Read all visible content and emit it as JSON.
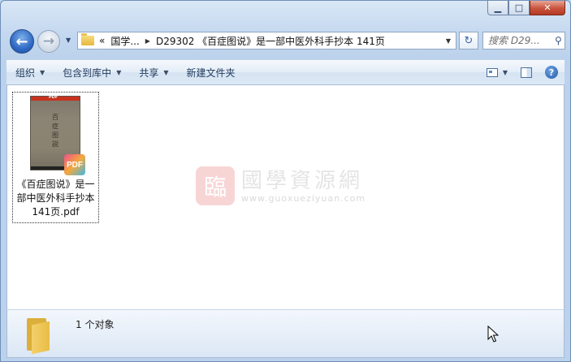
{
  "window": {
    "caption": {
      "minimize": "▁",
      "maximize": "□",
      "close": "✕"
    }
  },
  "nav": {
    "back_glyph": "←",
    "forward_glyph": "→",
    "breadcrumb": {
      "overflow": "«",
      "items": [
        "国学...",
        "D29302 《百症图说》是一部中医外科手抄本 141页"
      ]
    },
    "refresh_glyph": "↻"
  },
  "search": {
    "placeholder": "搜索 D29..."
  },
  "toolbar": {
    "organize": "组织",
    "include_library": "包含到库中",
    "share": "共享",
    "new_folder": "新建文件夹",
    "help_glyph": "?"
  },
  "file": {
    "name": "《百症图说》是一部中医外科手抄本141页.pdf",
    "badge": "PDF",
    "thumb_header": "PDF",
    "thumb_title": "百症图説"
  },
  "watermark": {
    "seal": "臨",
    "title": "國學資源網",
    "url": "www.guoxueziyuan.com"
  },
  "status": {
    "count_text": "1 个对象"
  }
}
